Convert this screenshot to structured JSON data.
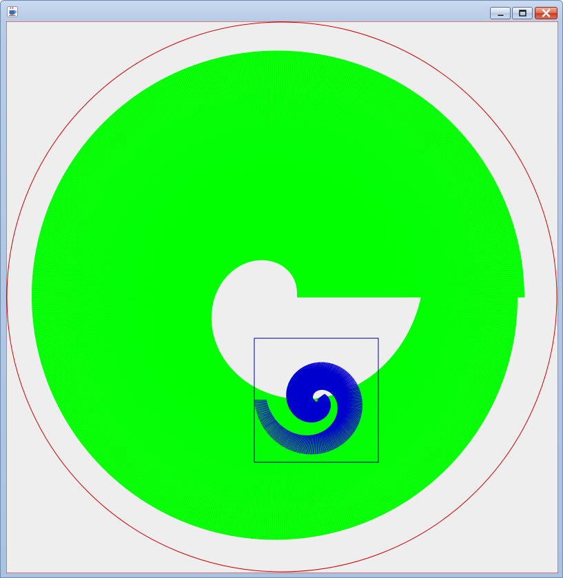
{
  "window": {
    "title": "",
    "controls": {
      "minimize_icon": "minimize-icon",
      "maximize_icon": "maximize-icon",
      "close_icon": "close-icon"
    },
    "app_icon": "java-coffee-cup-icon"
  },
  "canvas": {
    "background": "#eeeeee",
    "outer_circle_color": "#cc0000",
    "large_spiral_color": "#00ff00",
    "small_spiral_color": "#0000cc",
    "box_color": "#000080"
  }
}
